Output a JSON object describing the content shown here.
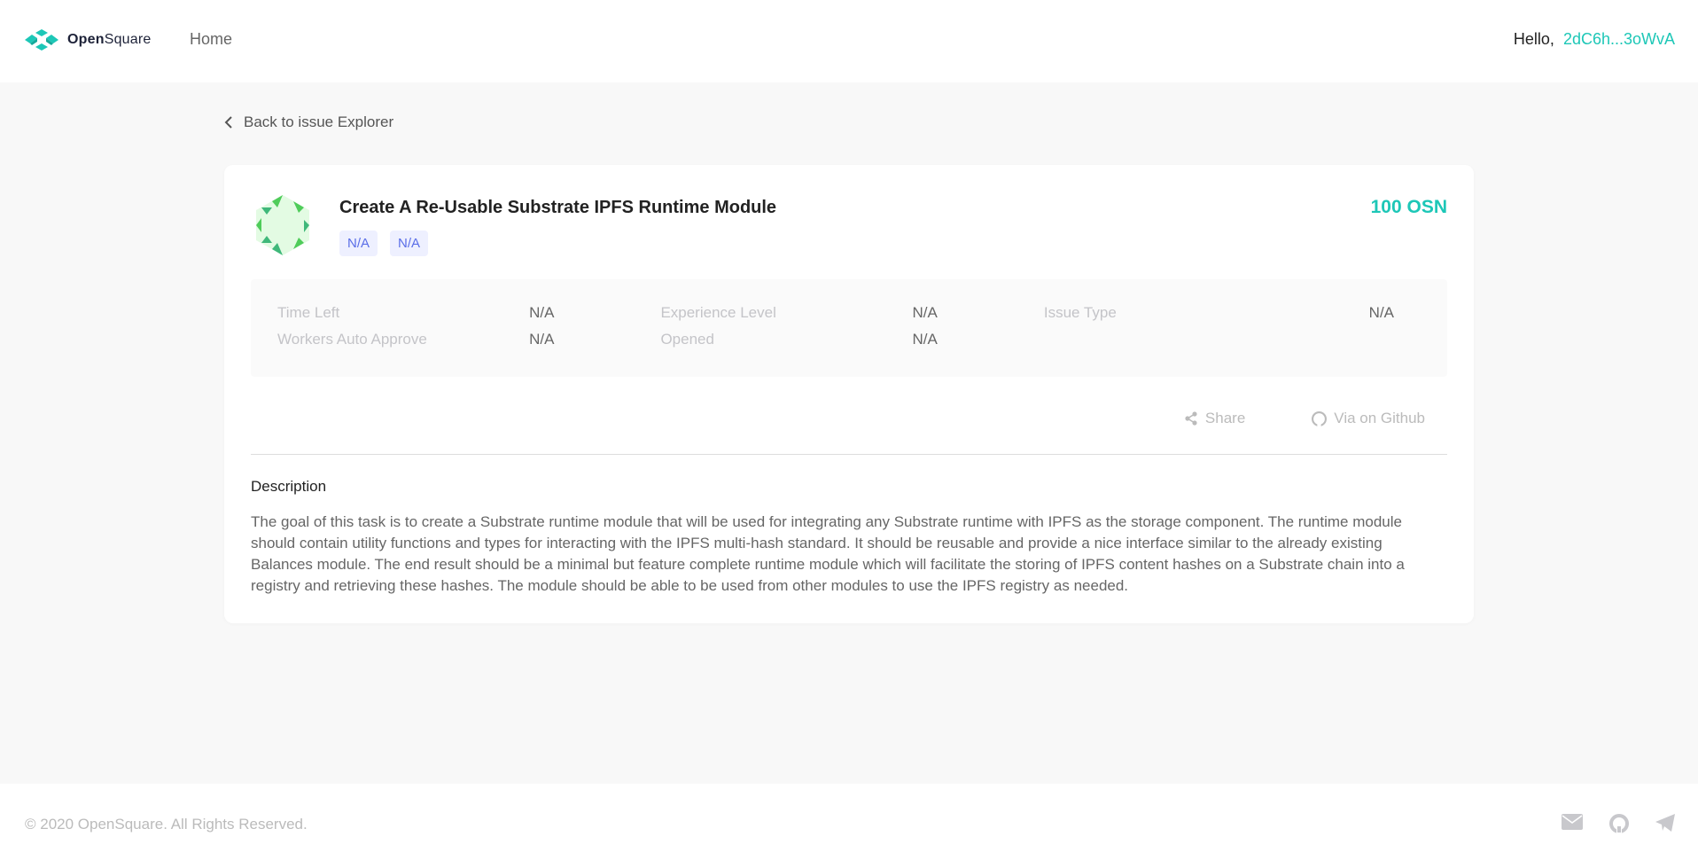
{
  "header": {
    "brand_a": "Open",
    "brand_b": "Square",
    "nav_home": "Home",
    "hello": "Hello,",
    "address": "2dC6h...3oWvA"
  },
  "back_label": "Back to issue Explorer",
  "issue": {
    "title": "Create A Re-Usable Substrate IPFS Runtime Module",
    "tags": [
      "N/A",
      "N/A"
    ],
    "reward": "100 OSN",
    "info": [
      [
        {
          "label": "Time Left",
          "value": "N/A"
        },
        {
          "label": "Workers Auto Approve",
          "value": "N/A"
        }
      ],
      [
        {
          "label": "Experience Level",
          "value": "N/A"
        },
        {
          "label": "Opened",
          "value": "N/A"
        }
      ],
      [
        {
          "label": "Issue Type",
          "value": "N/A"
        }
      ]
    ],
    "share_label": "Share",
    "github_label": "Via on Github",
    "description_heading": "Description",
    "description": "The goal of this task is to create a Substrate runtime module that will be used for integrating any Substrate runtime with IPFS as the storage component. The runtime module should contain utility functions and types for interacting with the IPFS multi-hash standard. It should be reusable and provide a nice interface similar to the already existing Balances module. The end result should be a minimal but feature complete runtime module which will facilitate the storing of IPFS content hashes on a Substrate chain into a registry and retrieving these hashes. The module should be able to be used from other modules to use the IPFS registry as needed."
  },
  "footer": {
    "copyright": "© 2020 OpenSquare. All Rights Reserved.",
    "icons": [
      "mail-icon",
      "github-icon",
      "telegram-icon"
    ]
  },
  "colors": {
    "accent": "#1dc7b7",
    "tag_bg": "#eef0ff",
    "tag_text": "#5a6ee8"
  }
}
